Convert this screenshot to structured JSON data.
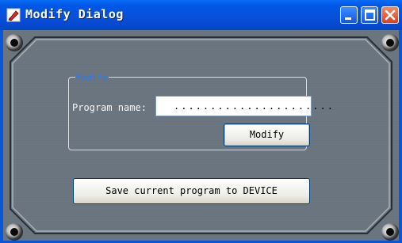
{
  "window": {
    "title": "Modify Dialog",
    "controls": {
      "minimize": "minimize",
      "maximize": "maximize",
      "close": "close"
    }
  },
  "modify_group": {
    "legend": "Modify",
    "program_name_label": "Program name:",
    "program_name_value": "......................",
    "modify_button": "Modify"
  },
  "save_button": "Save current program to DEVICE",
  "colors": {
    "titlebar": "#0a56d8",
    "panel": "#6c7680",
    "legend_text": "#2d7be8",
    "close_button": "#d8401e"
  }
}
